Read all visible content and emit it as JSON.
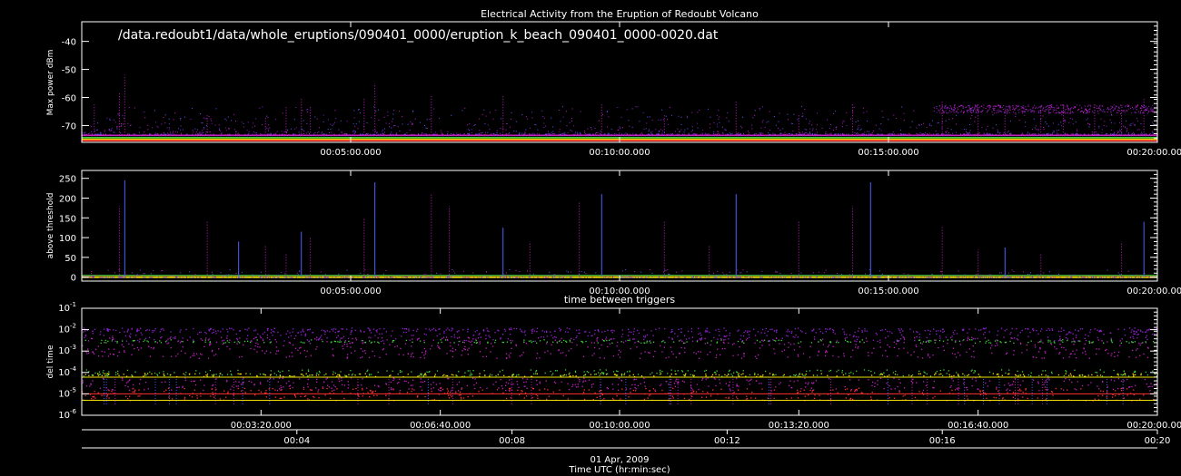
{
  "title": "Electrical Activity from the Eruption of Redoubt Volcano",
  "file_path": "/data.redoubt1/data/whole_eruptions/090401_0000/eruption_k_beach_090401_0000-0020.dat",
  "date_label": "01 Apr, 2009",
  "xlabel": "Time UTC (hr:min:sec)",
  "colors": {
    "background": "#000000",
    "axes": "#ffffff",
    "magenta": "#c020c0",
    "purple": "#9020d0",
    "blue": "#5060ff",
    "green": "#40d040",
    "yellow": "#f0e000",
    "red": "#ff3030",
    "cyan": "#20c0c0"
  },
  "chart_data": [
    {
      "type": "scatter",
      "ylabel": "Max power dBm",
      "ylim": [
        -76,
        -33
      ],
      "y_ticks": [
        -40,
        -50,
        -60,
        -70
      ],
      "x_ticks": [
        "00:05:00.000",
        "00:10:00.000",
        "00:15:00.000",
        "00:20:00.000"
      ],
      "x_tick_values": [
        300,
        600,
        900,
        1200
      ],
      "xlim": [
        0,
        1200
      ],
      "baseline_bands": [
        {
          "y": -73.5,
          "color": "magenta"
        },
        {
          "y": -74.3,
          "color": "green"
        },
        {
          "y": -74.9,
          "color": "yellow"
        },
        {
          "y": -75.4,
          "color": "red"
        }
      ],
      "spikes": [
        {
          "x": 14,
          "y": -62
        },
        {
          "x": 42,
          "y": -58
        },
        {
          "x": 48,
          "y": -52
        },
        {
          "x": 140,
          "y": -66
        },
        {
          "x": 205,
          "y": -67
        },
        {
          "x": 228,
          "y": -63
        },
        {
          "x": 245,
          "y": -60
        },
        {
          "x": 255,
          "y": -63
        },
        {
          "x": 315,
          "y": -60
        },
        {
          "x": 327,
          "y": -55
        },
        {
          "x": 390,
          "y": -59
        },
        {
          "x": 470,
          "y": -59
        },
        {
          "x": 580,
          "y": -62
        },
        {
          "x": 650,
          "y": -66
        },
        {
          "x": 730,
          "y": -61
        },
        {
          "x": 800,
          "y": -66
        },
        {
          "x": 860,
          "y": -62
        },
        {
          "x": 960,
          "y": -61
        },
        {
          "x": 1000,
          "y": -62
        },
        {
          "x": 1030,
          "y": -64
        },
        {
          "x": 1070,
          "y": -63
        },
        {
          "x": 1095,
          "y": -62
        },
        {
          "x": 1130,
          "y": -62
        },
        {
          "x": 1160,
          "y": -64
        },
        {
          "x": 1185,
          "y": -60
        }
      ],
      "elevated_band": {
        "x_start": 950,
        "x_end": 1200,
        "y": -64
      }
    },
    {
      "type": "scatter",
      "ylabel": "above threshold",
      "ylim": [
        -10,
        270
      ],
      "y_ticks": [
        0,
        50,
        100,
        150,
        200,
        250
      ],
      "x_ticks": [
        "00:05:00.000",
        "00:10:00.000",
        "00:15:00.000",
        "00:20:00.000"
      ],
      "x_tick_values": [
        300,
        600,
        900,
        1200
      ],
      "xlim": [
        0,
        1200
      ],
      "spikes": [
        {
          "x": 48,
          "y": 245
        },
        {
          "x": 42,
          "y": 180
        },
        {
          "x": 140,
          "y": 140
        },
        {
          "x": 175,
          "y": 90
        },
        {
          "x": 205,
          "y": 80
        },
        {
          "x": 228,
          "y": 60
        },
        {
          "x": 245,
          "y": 115
        },
        {
          "x": 255,
          "y": 100
        },
        {
          "x": 315,
          "y": 150
        },
        {
          "x": 327,
          "y": 240
        },
        {
          "x": 390,
          "y": 210
        },
        {
          "x": 410,
          "y": 180
        },
        {
          "x": 470,
          "y": 125
        },
        {
          "x": 500,
          "y": 90
        },
        {
          "x": 555,
          "y": 190
        },
        {
          "x": 580,
          "y": 210
        },
        {
          "x": 650,
          "y": 140
        },
        {
          "x": 700,
          "y": 80
        },
        {
          "x": 730,
          "y": 210
        },
        {
          "x": 800,
          "y": 140
        },
        {
          "x": 860,
          "y": 180
        },
        {
          "x": 880,
          "y": 240
        },
        {
          "x": 960,
          "y": 130
        },
        {
          "x": 1000,
          "y": 70
        },
        {
          "x": 1030,
          "y": 75
        },
        {
          "x": 1070,
          "y": 60
        },
        {
          "x": 1160,
          "y": 90
        },
        {
          "x": 1185,
          "y": 140
        }
      ]
    },
    {
      "type": "scatter",
      "title": "time between triggers",
      "ylabel": "del time",
      "yscale": "log",
      "ylim": [
        1e-06,
        0.1
      ],
      "y_ticks": [
        {
          "value": 0.1,
          "base": "10",
          "exp": "-1"
        },
        {
          "value": 0.01,
          "base": "10",
          "exp": "-2"
        },
        {
          "value": 0.001,
          "base": "10",
          "exp": "-3"
        },
        {
          "value": 0.0001,
          "base": "10",
          "exp": "-4"
        },
        {
          "value": 1e-05,
          "base": "10",
          "exp": "-5"
        },
        {
          "value": 1e-06,
          "base": "10",
          "exp": "-6"
        }
      ],
      "x_ticks": [
        "00:03:20.000",
        "00:06:40.000",
        "00:10:00.000",
        "00:13:20.000",
        "00:16:40.000",
        "00:20:00.000"
      ],
      "x_tick_values": [
        200,
        400,
        600,
        800,
        1000,
        1200
      ],
      "xlim": [
        0,
        1200
      ],
      "bands": [
        {
          "y": 0.0015,
          "color": "magenta",
          "spread": 0.5
        },
        {
          "y": 0.003,
          "color": "green",
          "spread": 0.08
        },
        {
          "y": 0.006,
          "color": "purple",
          "spread": 0.3
        },
        {
          "y": 0.01,
          "color": "purple",
          "spread": 0.1
        },
        {
          "y": 0.0001,
          "color": "green",
          "spread": 0.15
        },
        {
          "y": 8e-05,
          "color": "yellow",
          "spread": 0.08
        },
        {
          "y": 3e-05,
          "color": "magenta",
          "spread": 0.3
        },
        {
          "y": 1e-05,
          "color": "red",
          "spread": 0.3
        }
      ],
      "lines": [
        {
          "y": 6e-05,
          "color": "yellow"
        },
        {
          "y": 1e-05,
          "color": "red"
        },
        {
          "y": 5e-06,
          "color": "yellow"
        }
      ]
    }
  ],
  "secondary_axis": {
    "x_ticks": [
      "00:04",
      "00:08",
      "00:12",
      "00:16",
      "00:20"
    ],
    "x_tick_values": [
      240,
      480,
      720,
      960,
      1200
    ],
    "xlim": [
      0,
      1200
    ]
  }
}
